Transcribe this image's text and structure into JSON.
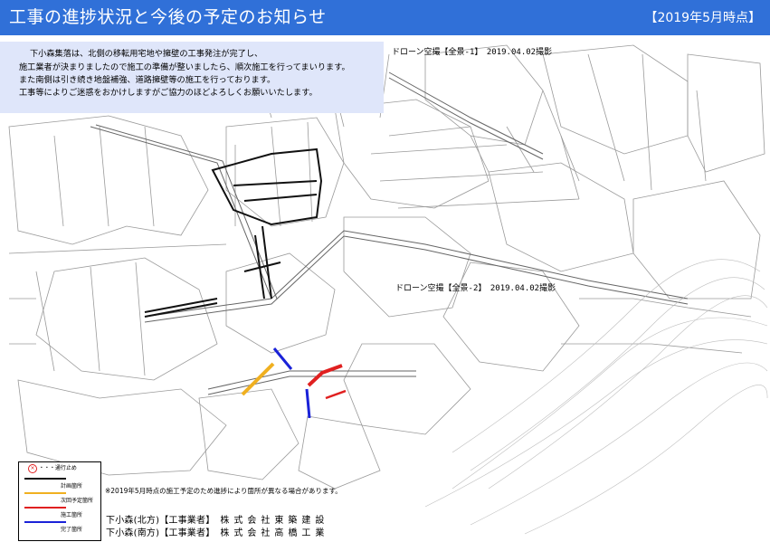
{
  "header": {
    "title": "工事の進捗状況と今後の予定のお知らせ",
    "as_of": "【2019年5月時点】"
  },
  "notice": {
    "lines": [
      "下小森集落は、北側の移転用宅地や擁壁の工事発注が完了し、",
      "施工業者が決まりましたので施工の準備が整いましたら、順次施工を行ってまいります。",
      "また南側は引き続き地盤補強、道路擁壁等の施工を行っております。",
      "工事等によりご迷惑をおかけしますがご協力のほどよろしくお願いいたします。"
    ]
  },
  "map": {
    "photo_caption_1": "ドローン空撮【全景-1】　2019.04.02撮影",
    "photo_caption_2": "ドローン空撮【全景-2】　2019.04.02撮影",
    "colors": {
      "planned": "#111111",
      "next_scheduled": "#f0b020",
      "under_construction": "#e02020",
      "completed": "#1a22d8"
    }
  },
  "legend": {
    "road_closed": "・・・通行止め",
    "planned": "計画箇所",
    "next_scheduled": "次回予定箇所",
    "under_construction": "施工箇所",
    "completed": "完了箇所"
  },
  "footnote": "※2019年5月時点の施工予定のため進捗により箇所が異なる場合があります。",
  "contractors": [
    {
      "area": "下小森(北方)【工事業者】",
      "firm": "株式会社東築建設"
    },
    {
      "area": "下小森(南方)【工事業者】",
      "firm": "株式会社高橋工業"
    }
  ]
}
